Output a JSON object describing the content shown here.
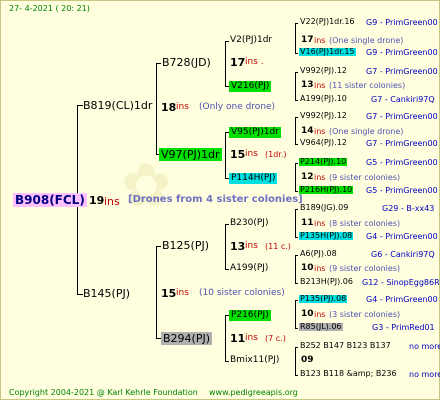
{
  "header": "27-   4-2021  ( 20:  21)",
  "footer": {
    "copyright": "Copyright 2004-2021 @ Karl Kehrle Foundation",
    "site": "www.pedigreeapis.org"
  },
  "root": {
    "name": "B908(FCL)",
    "num": "19",
    "ins": "ins",
    "note": "[Drones from 4 sister colonies]"
  },
  "sire": {
    "name": "B819(CL)1dr",
    "num": "18",
    "ins": "ins",
    "note": "(Only one drone)"
  },
  "dam": {
    "name": "B145(PJ)",
    "num": "15",
    "ins": "ins",
    "note": "(10 sister colonies)"
  },
  "l2": {
    "a": {
      "name": "B728(JD)",
      "num": "17",
      "ins": "ins ."
    },
    "b": {
      "name": "V97(PJ)1dr",
      "num": "15",
      "ins": "ins",
      "note": "(1dr.)"
    },
    "c": {
      "name": "B125(PJ)",
      "num": "13",
      "ins": "ins",
      "note": "(11 c.)"
    },
    "d": {
      "name": "B294(PJ)",
      "num": "11",
      "ins": "ins",
      "note": "(7 c.)"
    }
  },
  "l3": {
    "a1": {
      "name": "V2(PJ)1dr",
      "num": "17",
      "ins": "ins",
      "note": "(One single drone)"
    },
    "a2": {
      "name": "V216(PJ)",
      "num": "13",
      "ins": "ins",
      "note": "(11 sister colonies)"
    },
    "b1": {
      "name": "V95(PJ)1dr",
      "num": "14",
      "ins": "ins",
      "note": "(One single drone)"
    },
    "b2": {
      "name": "P114H(PJ)",
      "num": "12",
      "ins": "ins",
      "note": "(9 sister colonies)"
    },
    "c1": {
      "name": "B230(PJ)",
      "num": "11",
      "ins": "ins",
      "note": "(8 sister colonies)"
    },
    "c2": {
      "name": "A199(PJ)",
      "num": "10",
      "ins": "ins",
      "note": "(9 sister colonies)"
    },
    "d1": {
      "name": "P216(PJ)",
      "num": "10",
      "ins": "ins",
      "note": "(3 sister colonies)"
    },
    "d2": {
      "name": "Bmix11(PJ)",
      "num": "09"
    }
  },
  "l4": [
    {
      "name": "V22(PJ)1dr.16",
      "ref": "G9 - PrimGreen00"
    },
    {
      "name": "V16(PJ)1dr.15",
      "ref": "G9 - PrimGreen00"
    },
    {
      "name": "V992(PJ).12",
      "ref": "G7 - PrimGreen00"
    },
    {
      "name": "A199(PJ).10",
      "ref": "G7 - Cankiri97Q"
    },
    {
      "name": "V992(PJ).12",
      "ref": "G7 - PrimGreen00"
    },
    {
      "name": "V964(PJ).12",
      "ref": "G7 - PrimGreen00"
    },
    {
      "name": "P214(PJ).10",
      "ref": "G5 - PrimGreen00"
    },
    {
      "name": "P216H(PJ).10",
      "ref": "G5 - PrimGreen00"
    },
    {
      "name": "B189(JG).09",
      "ref": "G29 - B-xx43"
    },
    {
      "name": "P135H(PJ).08",
      "ref": "G4 - PrimGreen00"
    },
    {
      "name": "A6(PJ).08",
      "ref": "G6 - Cankiri97Q"
    },
    {
      "name": "B213H(PJ).06",
      "ref": "G12 - SinopEgg86R"
    },
    {
      "name": "P135(PJ).08",
      "ref": "G4 - PrimGreen00"
    },
    {
      "name": "R85(JL).06",
      "ref": "G3 - PrimRed01"
    },
    {
      "name": "B252 B147 B123 B137",
      "ref": "no more"
    },
    {
      "name": "B123 B118 &amp; B236",
      "ref": "no more"
    }
  ]
}
